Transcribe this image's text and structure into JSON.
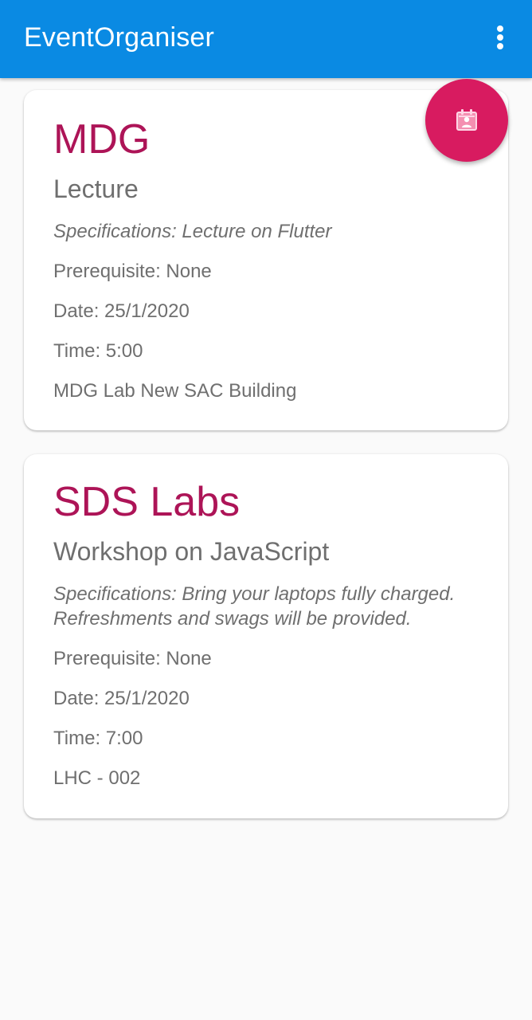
{
  "app_bar": {
    "title": "EventOrganiser",
    "menu_icon": "more-vert-icon",
    "color": "#0a8ae3"
  },
  "fab": {
    "icon": "calendar-person-icon",
    "color": "#d81b60"
  },
  "events": [
    {
      "organizer": "MDG",
      "title": "Lecture",
      "specifications": "Specifications: Lecture on Flutter",
      "prerequisite": "Prerequisite: None",
      "date": "Date: 25/1/2020",
      "time": "Time: 5:00",
      "venue": "MDG Lab New SAC Building"
    },
    {
      "organizer": "SDS Labs",
      "title": "Workshop on JavaScript",
      "specifications": "Specifications: Bring your laptops fully charged. Refreshments and swags will be provided.",
      "prerequisite": "Prerequisite: None",
      "date": "Date: 25/1/2020",
      "time": "Time: 7:00",
      "venue": "LHC - 002"
    }
  ],
  "colors": {
    "accent_text": "#ad1457",
    "body_text": "#6f6f6f",
    "background": "#fafafa"
  }
}
